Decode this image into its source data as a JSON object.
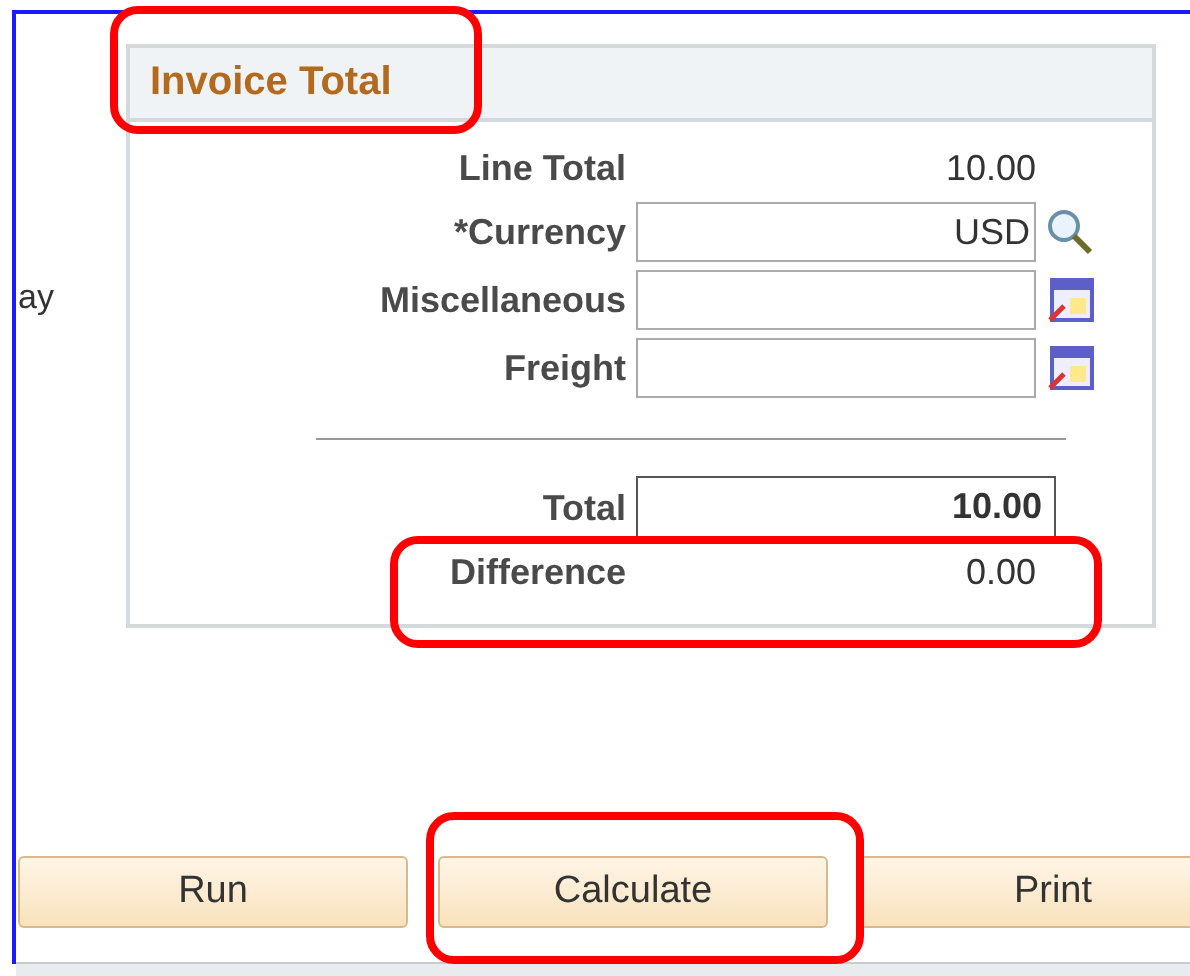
{
  "side_text": "ay",
  "panel": {
    "title": "Invoice Total",
    "rows": [
      {
        "kind": "readout",
        "label": "Line Total",
        "value": "10.00"
      },
      {
        "kind": "lookup",
        "label": "*Currency",
        "value": "USD"
      },
      {
        "kind": "picker",
        "label": "Miscellaneous",
        "value": ""
      },
      {
        "kind": "picker",
        "label": "Freight",
        "value": ""
      },
      {
        "kind": "divider"
      },
      {
        "kind": "boxed",
        "label": "Total",
        "value": "10.00"
      },
      {
        "kind": "readout",
        "label": "Difference",
        "value": "0.00"
      }
    ]
  },
  "buttons": [
    "Run",
    "Calculate",
    "Print"
  ]
}
